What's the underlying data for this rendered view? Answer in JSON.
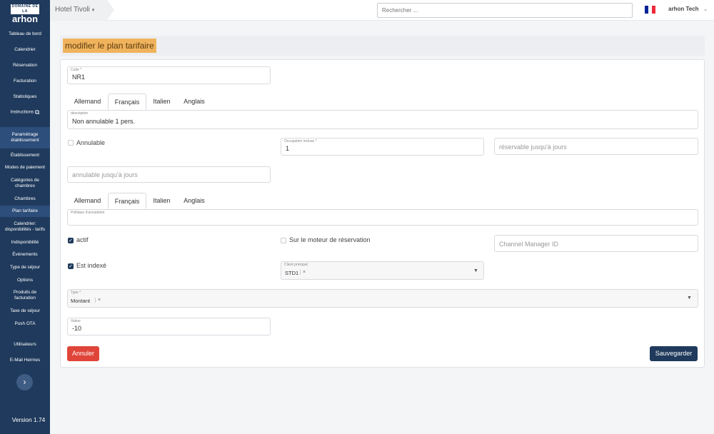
{
  "sidebar": {
    "logo_top": "DOMAINE DE LA",
    "logo": "arhon",
    "items": [
      {
        "label": "Tableau de bord"
      },
      {
        "label": "Calendrier"
      },
      {
        "label": "Réservation"
      },
      {
        "label": "Facturation"
      },
      {
        "label": "Statistiques"
      },
      {
        "label": "Instructions"
      },
      {
        "label": "Paramétrage établissement"
      },
      {
        "label": "Établissement"
      },
      {
        "label": "Modes de paiement"
      },
      {
        "label": "Catégories de chambres"
      },
      {
        "label": "Chambres"
      },
      {
        "label": "Plan tarifaire"
      },
      {
        "label": "Calendrier: disponibilités - tarifs"
      },
      {
        "label": "Indisponibilité"
      },
      {
        "label": "Évènements"
      },
      {
        "label": "Type de séjour"
      },
      {
        "label": "Options"
      },
      {
        "label": "Produits de facturation"
      },
      {
        "label": "Taxe de séjour"
      },
      {
        "label": "Push OTA"
      },
      {
        "label": "Utilisateurs"
      },
      {
        "label": "E-Mail Hermes"
      }
    ],
    "toggle": "›",
    "version": "Version 1.74"
  },
  "topbar": {
    "hotel": "Hotel Tivoli",
    "hotel_caret": "▾",
    "search_placeholder": "Rechercher ...",
    "user": "arhon Tech",
    "user_caret": "⌄",
    "flag_colors": [
      "#002395",
      "#ffffff",
      "#ed2939"
    ]
  },
  "page": {
    "title": "modifier le plan tarifaire"
  },
  "form": {
    "code_label": "Code *",
    "code_value": "NR1",
    "tabs": [
      "Allemand",
      "Français",
      "Italien",
      "Anglais"
    ],
    "active_tab": "Français",
    "description_label": "description",
    "description_value": "Non annulable 1 pers.",
    "annulable_label": "Annulable",
    "annulable_checked": false,
    "occupation_label": "Occupation incluse *",
    "occupation_value": "1",
    "reservable_placeholder": "réservable jusqu'à jours",
    "annulable_days_placeholder": "annulable jusqu'à jours",
    "politique_label": "Politique d'annulation",
    "actif_label": "actif",
    "actif_checked": true,
    "moteur_label": "Sur le moteur de réservation",
    "moteur_checked": false,
    "channel_placeholder": "Channel Manager ID",
    "indexe_label": "Est indexé",
    "indexe_checked": true,
    "client_label": "Client principal",
    "client_value": "STD1",
    "type_label": "Type *",
    "type_value": "Montant",
    "remove_glyph": "×",
    "dropdown_glyph": "▼",
    "check_glyph": "✓",
    "valeur_label": "Valeur",
    "valeur_value": "-10",
    "cancel_label": "Annuler",
    "save_label": "Sauvegarder"
  },
  "colors": {
    "sidebar_bg": "#1f3a5c",
    "title_highlight": "#f0b35c",
    "cancel": "#e0453a",
    "save": "#1f3a5c"
  }
}
